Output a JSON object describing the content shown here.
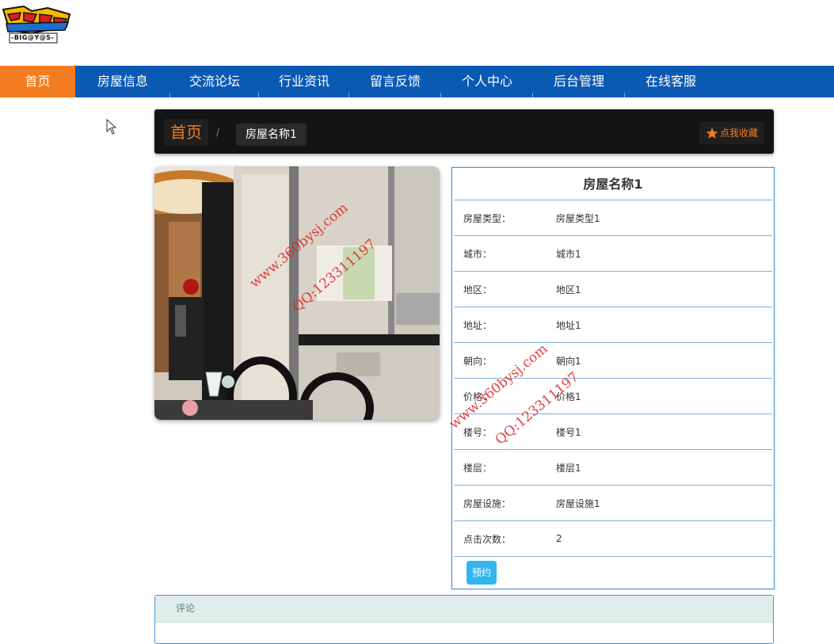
{
  "logo": {
    "text": "-BIG@Y@S-"
  },
  "nav": {
    "items": [
      "首页",
      "房屋信息",
      "交流论坛",
      "行业资讯",
      "留言反馈",
      "个人中心",
      "后台管理",
      "在线客服"
    ]
  },
  "breadcrumb": {
    "home": "首页",
    "separator": "/",
    "current": "房屋名称1"
  },
  "favorite": {
    "label": "点我收藏",
    "icon": "star-icon"
  },
  "watermarks": [
    "www.360bysj.com",
    "QQ:123311197",
    "www.360bysj.com",
    "QQ:123311197"
  ],
  "detail": {
    "title": "房屋名称1",
    "rows": [
      {
        "label": "房屋类型：",
        "value": "房屋类型1"
      },
      {
        "label": "城市：",
        "value": "城市1"
      },
      {
        "label": "地区：",
        "value": "地区1"
      },
      {
        "label": "地址：",
        "value": "地址1"
      },
      {
        "label": "朝向：",
        "value": "朝向1"
      },
      {
        "label": "价格：",
        "value": "价格1"
      },
      {
        "label": "楼号：",
        "value": "楼号1"
      },
      {
        "label": "楼层：",
        "value": "楼层1"
      },
      {
        "label": "房屋设施：",
        "value": "房屋设施1"
      },
      {
        "label": "点击次数：",
        "value": "2"
      }
    ],
    "book_label": "预约"
  },
  "comment": {
    "title": "评论"
  },
  "colors": {
    "nav": "#0a59b3",
    "accent": "#f47c20",
    "panel_border": "#4a90d9",
    "button": "#33b5ee"
  }
}
